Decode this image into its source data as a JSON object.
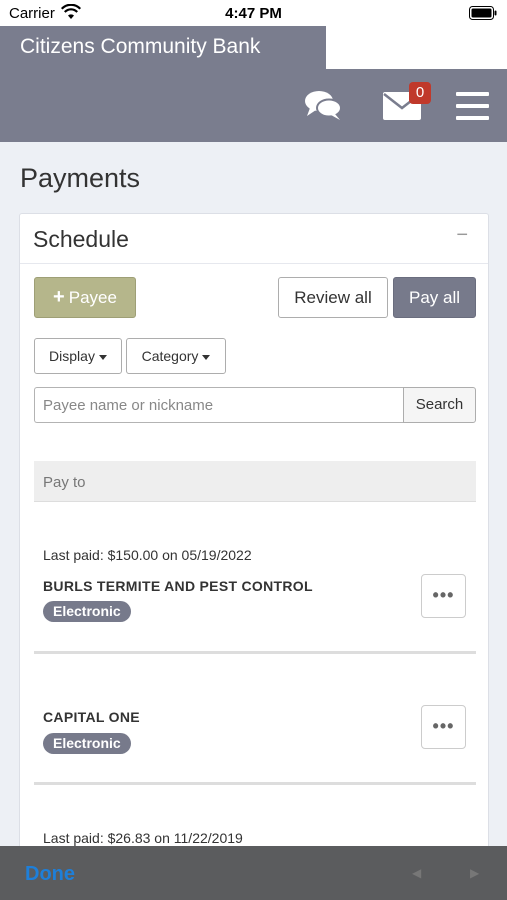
{
  "status_bar": {
    "carrier": "Carrier",
    "time": "4:47 PM"
  },
  "header": {
    "bank_name": "Citizens Community Bank",
    "mail_count": "0"
  },
  "page": {
    "title": "Payments"
  },
  "schedule": {
    "title": "Schedule",
    "collapse_symbol": "−",
    "add_payee_label": "Payee",
    "review_all_label": "Review all",
    "pay_all_label": "Pay all",
    "display_label": "Display",
    "category_label": "Category",
    "search_placeholder": "Payee name or nickname",
    "search_label": "Search",
    "pay_to_label": "Pay to",
    "payees": [
      {
        "last_paid": "Last paid: $150.00 on 05/19/2022",
        "name": "BURLS TERMITE AND PEST CONTROL",
        "type": "Electronic"
      },
      {
        "last_paid": "",
        "name": "CAPITAL ONE",
        "type": "Electronic"
      },
      {
        "last_paid": "Last paid: $26.83 on 11/22/2019",
        "name": "",
        "type": ""
      }
    ]
  },
  "toolbar": {
    "done_label": "Done",
    "prev_symbol": "◀",
    "next_symbol": "▶"
  },
  "colors": {
    "header_bg": "#7a7d8e",
    "payee_button": "#b5b68b",
    "pay_all_button": "#777a8b",
    "badge": "#c0392b",
    "done": "#1e7fd9"
  }
}
